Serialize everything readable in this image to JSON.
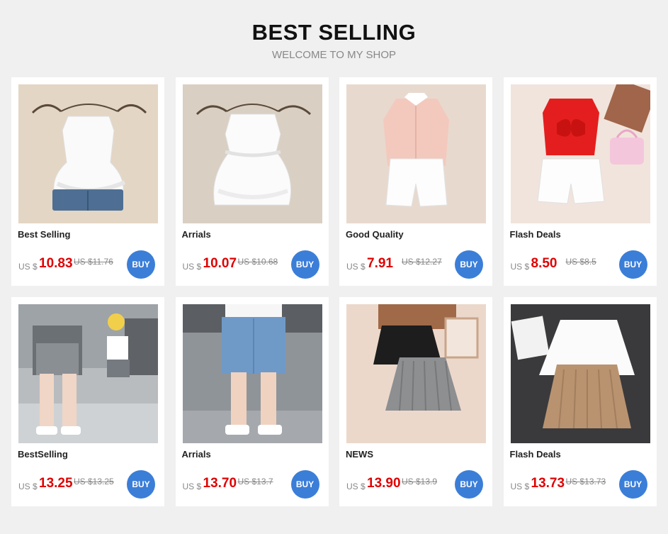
{
  "header": {
    "title": "BEST SELLING",
    "subtitle": "WELCOME TO MY SHOP"
  },
  "colors": {
    "background": "#f0f0f0",
    "price": "#e00000",
    "buy_button": "#3b7ed8"
  },
  "products": [
    {
      "name": "Best Selling",
      "currency": "US $",
      "price": "10.83",
      "old_price": "US $11.76",
      "buy_label": "BUY",
      "image": "white ruffle top and denim shorts on hanger"
    },
    {
      "name": "Arrials",
      "currency": "US $",
      "price": "10.07",
      "old_price": "US $10.68",
      "buy_label": "BUY",
      "image": "white ruffle sleeveless top set on hanger"
    },
    {
      "name": "Good Quality",
      "currency": "US $",
      "price": "7.91",
      "old_price": "US $12.27",
      "buy_label": "BUY",
      "image": "pink shirt and white shorts"
    },
    {
      "name": "Flash Deals",
      "currency": "US $",
      "price": "8.50",
      "old_price": "US $8.5",
      "buy_label": "BUY",
      "image": "red bow top, white shorts and pink bag"
    },
    {
      "name": "BestSelling",
      "currency": "US $",
      "price": "13.25",
      "old_price": "US $13.25",
      "buy_label": "BUY",
      "image": "girl wearing grey denim shorts"
    },
    {
      "name": "Arrials",
      "currency": "US $",
      "price": "13.70",
      "old_price": "US $13.7",
      "buy_label": "BUY",
      "image": "girl wearing blue denim shorts"
    },
    {
      "name": "NEWS",
      "currency": "US $",
      "price": "13.90",
      "old_price": "US $13.9",
      "buy_label": "BUY",
      "image": "black and grey pleated skirts"
    },
    {
      "name": "Flash Deals",
      "currency": "US $",
      "price": "13.73",
      "old_price": "US $13.73",
      "buy_label": "BUY",
      "image": "white and khaki pleated skirts"
    }
  ]
}
